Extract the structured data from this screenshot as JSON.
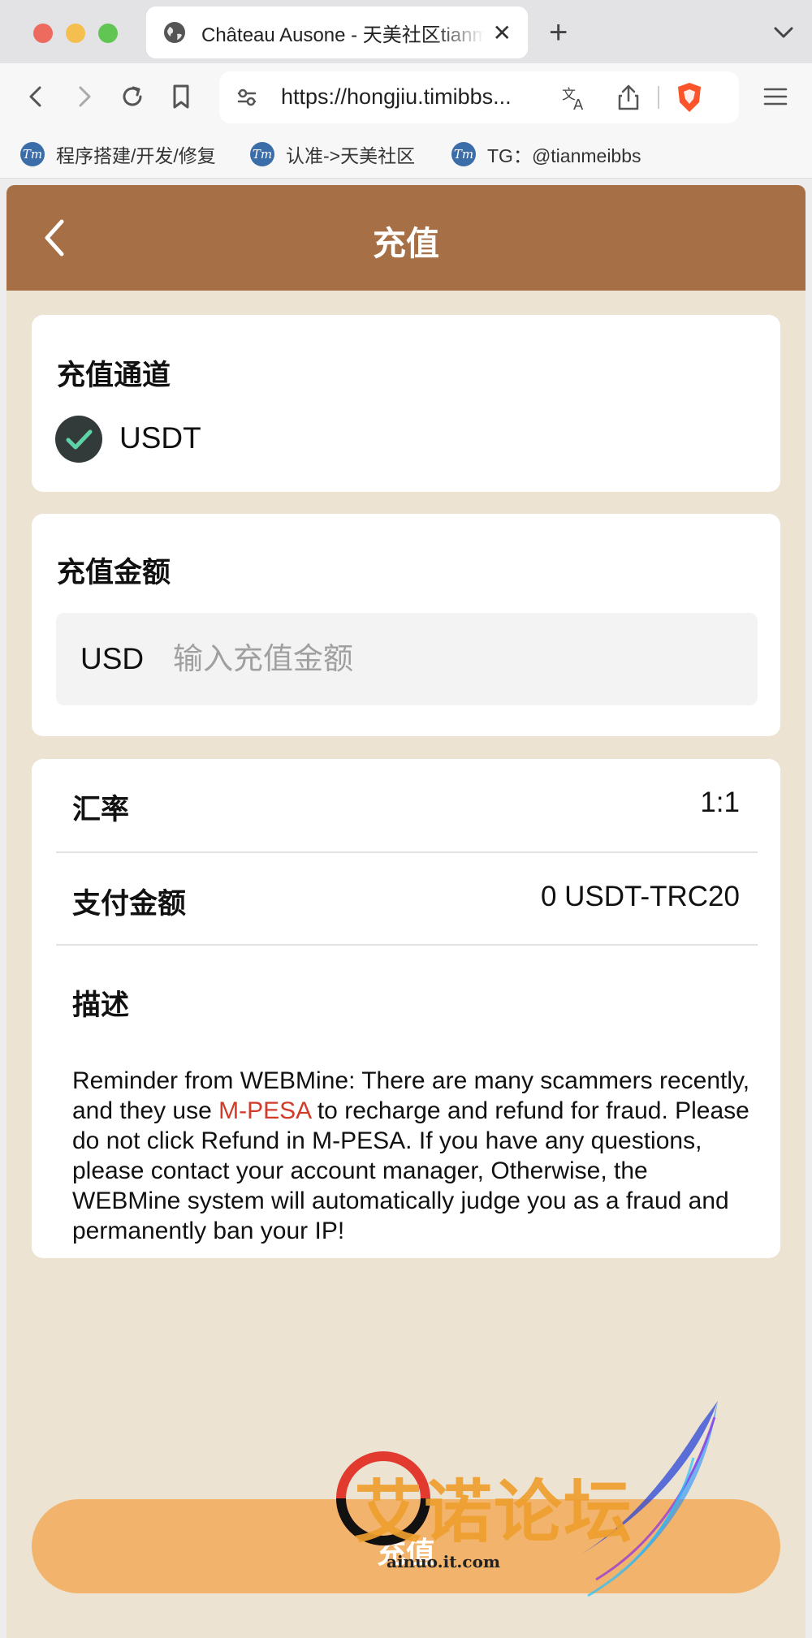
{
  "browser": {
    "tab_title": "Château Ausone - 天美社区tianmeibbs",
    "tab_close": "✕",
    "new_tab": "+",
    "url": "https://hongjiu.timibbs.com/#/recharge",
    "url_display": "https://hongjiu.timibbs...",
    "bookmarks": [
      {
        "label": "程序搭建/开发/修复"
      },
      {
        "label": "认准->天美社区"
      },
      {
        "label": "TG：@tianmeibbs"
      }
    ],
    "bookmark_logo_text": "Tm"
  },
  "header": {
    "title": "充值"
  },
  "channel": {
    "heading": "充值通道",
    "selected": "USDT"
  },
  "amount": {
    "heading": "充值金额",
    "currency": "USD",
    "placeholder": "输入充值金额",
    "value": ""
  },
  "summary": {
    "rate_label": "汇率",
    "rate_value": "1:1",
    "pay_label": "支付金额",
    "pay_value": "0 USDT-TRC20"
  },
  "description": {
    "heading": "描述",
    "text_before": "Reminder from WEBMine: There are many scammers recently, and they use ",
    "highlight": "M-PESA",
    "text_after": " to recharge and refund for fraud. Please do not click Refund in M-PESA. If you have any questions, please contact your account manager, Otherwise, the WEBMine system will automatically judge you as a fraud and permanently ban your IP!"
  },
  "submit": {
    "label": "充值"
  },
  "watermark": {
    "text": "艾诺论坛",
    "url": "ainuo.it.com"
  },
  "colors": {
    "header": "#a66f46",
    "page_background": "#ede3d2",
    "button": "#f2b46d",
    "highlight": "#d03b2a",
    "check": "#333a3a",
    "check_mark": "#5fd3a8"
  }
}
